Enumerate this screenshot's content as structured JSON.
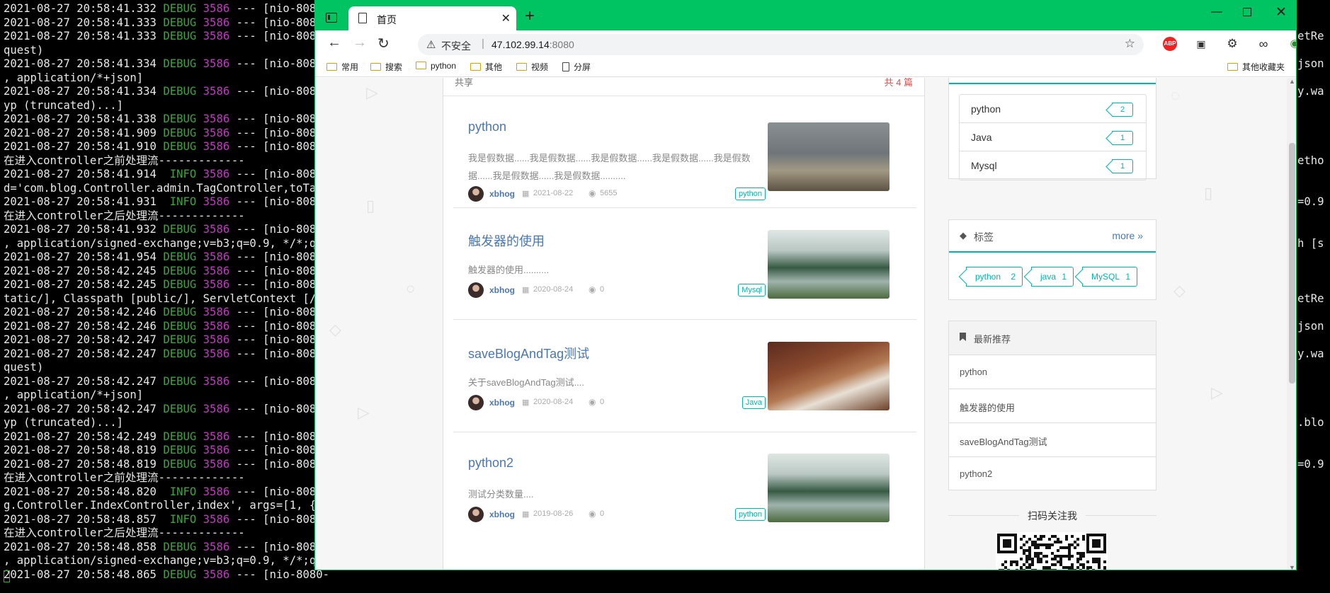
{
  "terminal": {
    "lines": [
      {
        "ts": "2021-08-27 20:58:41.332",
        "level": "DEBUG",
        "pid": "3586",
        "rest": "--- [nio-8080-"
      },
      {
        "ts": "2021-08-27 20:58:41.333",
        "level": "DEBUG",
        "pid": "3586",
        "rest": "--- [nio-8080-"
      },
      {
        "ts": "2021-08-27 20:58:41.333",
        "level": "DEBUG",
        "pid": "3586",
        "rest": "--- [nio-8080-"
      },
      {
        "text": "quest)"
      },
      {
        "ts": "2021-08-27 20:58:41.334",
        "level": "DEBUG",
        "pid": "3586",
        "rest": "--- [nio-8080-"
      },
      {
        "text": ", application/*+json]"
      },
      {
        "ts": "2021-08-27 20:58:41.334",
        "level": "DEBUG",
        "pid": "3586",
        "rest": "--- [nio-8080-"
      },
      {
        "text": "yp (truncated)...]"
      },
      {
        "ts": "2021-08-27 20:58:41.338",
        "level": "DEBUG",
        "pid": "3586",
        "rest": "--- [nio-8080-"
      },
      {
        "ts": "2021-08-27 20:58:41.909",
        "level": "DEBUG",
        "pid": "3586",
        "rest": "--- [nio-8080-"
      },
      {
        "ts": "2021-08-27 20:58:41.910",
        "level": "DEBUG",
        "pid": "3586",
        "rest": "--- [nio-8080-"
      },
      {
        "text": "在进入controller之前处理流-------------"
      },
      {
        "ts": "2021-08-27 20:58:41.914",
        "level": " INFO",
        "pid": "3586",
        "rest": "--- [nio-8080-"
      },
      {
        "text": "d='com.blog.Controller.admin.TagController,toTags"
      },
      {
        "ts": "2021-08-27 20:58:41.931",
        "level": " INFO",
        "pid": "3586",
        "rest": "--- [nio-8080-"
      },
      {
        "text": "在进入controller之后处理流-------------"
      },
      {
        "ts": "2021-08-27 20:58:41.932",
        "level": "DEBUG",
        "pid": "3586",
        "rest": "--- [nio-8080-"
      },
      {
        "text": ", application/signed-exchange;v=b3;q=0.9, */*;q=0"
      },
      {
        "ts": "2021-08-27 20:58:41.954",
        "level": "DEBUG",
        "pid": "3586",
        "rest": "--- [nio-8080-"
      },
      {
        "ts": "2021-08-27 20:58:42.245",
        "level": "DEBUG",
        "pid": "3586",
        "rest": "--- [nio-8080-"
      },
      {
        "ts": "2021-08-27 20:58:42.245",
        "level": "DEBUG",
        "pid": "3586",
        "rest": "--- [nio-8080-"
      },
      {
        "text": "tatic/], Classpath [public/], ServletContext [/]]"
      },
      {
        "ts": "2021-08-27 20:58:42.246",
        "level": "DEBUG",
        "pid": "3586",
        "rest": "--- [nio-8080-"
      },
      {
        "ts": "2021-08-27 20:58:42.246",
        "level": "DEBUG",
        "pid": "3586",
        "rest": "--- [nio-8080-"
      },
      {
        "ts": "2021-08-27 20:58:42.247",
        "level": "DEBUG",
        "pid": "3586",
        "rest": "--- [nio-8080-"
      },
      {
        "ts": "2021-08-27 20:58:42.247",
        "level": "DEBUG",
        "pid": "3586",
        "rest": "--- [nio-8080-"
      },
      {
        "text": "quest)"
      },
      {
        "ts": "2021-08-27 20:58:42.247",
        "level": "DEBUG",
        "pid": "3586",
        "rest": "--- [nio-8080-"
      },
      {
        "text": ", application/*+json]"
      },
      {
        "ts": "2021-08-27 20:58:42.247",
        "level": "DEBUG",
        "pid": "3586",
        "rest": "--- [nio-8080-"
      },
      {
        "text": "yp (truncated)...]"
      },
      {
        "ts": "2021-08-27 20:58:42.249",
        "level": "DEBUG",
        "pid": "3586",
        "rest": "--- [nio-8080-"
      },
      {
        "ts": "2021-08-27 20:58:48.819",
        "level": "DEBUG",
        "pid": "3586",
        "rest": "--- [nio-8080-"
      },
      {
        "ts": "2021-08-27 20:58:48.819",
        "level": "DEBUG",
        "pid": "3586",
        "rest": "--- [nio-8080-"
      },
      {
        "text": "在进入controller之前处理流-------------"
      },
      {
        "ts": "2021-08-27 20:58:48.820",
        "level": " INFO",
        "pid": "3586",
        "rest": "--- [nio-8080-"
      },
      {
        "text": "g.Controller.IndexController,index', args=[1, {}]"
      },
      {
        "ts": "2021-08-27 20:58:48.857",
        "level": " INFO",
        "pid": "3586",
        "rest": "--- [nio-8080-"
      },
      {
        "text": "在进入controller之后处理流-------------"
      },
      {
        "ts": "2021-08-27 20:58:48.858",
        "level": "DEBUG",
        "pid": "3586",
        "rest": "--- [nio-8080-"
      },
      {
        "text": ", application/signed-exchange;v=b3;q=0.9, */*;q=0"
      },
      {
        "ts": "2021-08-27 20:58:48.865",
        "level": "DEBUG",
        "pid": "3586",
        "rest": "--- [nio-8080-"
      }
    ],
    "right_fragments": [
      {
        "line": 2,
        "text": "etRe"
      },
      {
        "line": 4,
        "text": "json"
      },
      {
        "line": 6,
        "text": "y.wa"
      },
      {
        "line": 11,
        "text": "etho"
      },
      {
        "line": 14,
        "text": "=0.9"
      },
      {
        "line": 17,
        "text": "h [s"
      },
      {
        "line": 21,
        "text": "etRe"
      },
      {
        "line": 23,
        "text": "json"
      },
      {
        "line": 25,
        "text": "y.wa"
      },
      {
        "line": 30,
        "text": ".blo"
      },
      {
        "line": 33,
        "text": "=0.9"
      }
    ]
  },
  "browser": {
    "tab_title": "首页",
    "tab_close": "✕",
    "new_tab": "+",
    "win_min": "—",
    "win_close": "✕",
    "nav_back": "←",
    "nav_fwd": "→",
    "nav_reload": "↻",
    "warn_icon": "⚠",
    "insecure_label": "不安全",
    "url_sep": "|",
    "url_host": "47.102.99.14",
    "url_port": ":8080",
    "fav_add": "☆",
    "ext_abp": "ABP",
    "ext_box": "▣",
    "ext_gear": "⚙",
    "ext_inf": "∞",
    "ext_globe": "◉",
    "ext_puzzle": "✥",
    "ext_favs": "✩",
    "ext_coll": "⧉",
    "ext_more": "⋯",
    "bookmarks": [
      "常用",
      "搜索",
      "python",
      "其他",
      "视频"
    ],
    "bookmark_page": "分屏",
    "other_bookmarks": "其他收藏夹"
  },
  "page": {
    "list_header_left": "共享",
    "list_header_right": "共 4 篇",
    "posts": [
      {
        "title": "python",
        "desc": "我是假数据......我是假数据......我是假数据......我是假数据......我是假数据......我是假数据......我是假数据..........",
        "author": "xbhog",
        "date": "2021-08-22",
        "views": "5655",
        "tag": "python"
      },
      {
        "title": "触发器的使用",
        "desc": "触发器的使用..........",
        "author": "xbhog",
        "date": "2020-08-24",
        "views": "0",
        "tag": "Mysql"
      },
      {
        "title": "saveBlogAndTag测试",
        "desc": "关于saveBlogAndTag测试....",
        "author": "xbhog",
        "date": "2020-08-24",
        "views": "0",
        "tag": "Java"
      },
      {
        "title": "python2",
        "desc": "测试分类数量....",
        "author": "xbhog",
        "date": "2019-08-26",
        "views": "0",
        "tag": "python"
      }
    ],
    "date_icon": "▦",
    "eye_icon": "◉",
    "types": [
      {
        "name": "python",
        "count": "2"
      },
      {
        "name": "Java",
        "count": "1"
      },
      {
        "name": "Mysql",
        "count": "1"
      }
    ],
    "tags_icon": "◆",
    "tags_title": "标签",
    "tags_more": "more »",
    "tags": [
      {
        "name": "python",
        "count": "2"
      },
      {
        "name": "java",
        "count": "1"
      },
      {
        "name": "MySQL",
        "count": "1"
      }
    ],
    "recommend_title": "最新推荐",
    "recommend": [
      "python",
      "触发器的使用",
      "saveBlogAndTag测试",
      "python2"
    ],
    "follow_title": "扫码关注我"
  }
}
